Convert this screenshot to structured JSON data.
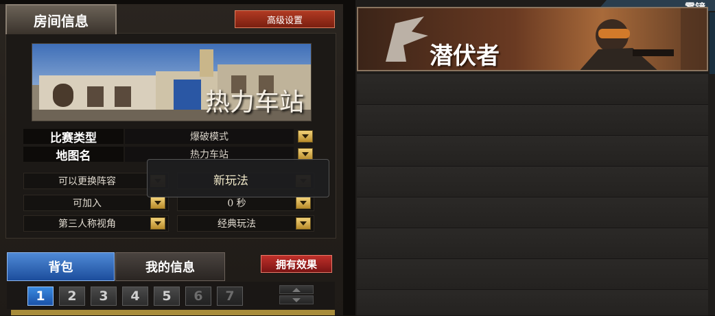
{
  "room": {
    "title": "房间信息",
    "advanced_button": "高级设置",
    "map_overlay_text": "热力车站",
    "settings": [
      {
        "label": "比赛类型",
        "value": "爆破模式"
      },
      {
        "label": "地图名",
        "value": "热力车站"
      }
    ],
    "options": {
      "change_team": "可以更换阵容",
      "joinable": "可加入",
      "timer": "0 秒",
      "third_person": "第三人称视角",
      "gameplay": "经典玩法"
    },
    "tooltip": "新玩法"
  },
  "inventory": {
    "tabs": [
      "背包",
      "我的信息"
    ],
    "active_tab": 0,
    "effect_button": "拥有效果",
    "pages": [
      "1",
      "2",
      "3",
      "4",
      "5",
      "6",
      "7"
    ],
    "active_page": 0,
    "disabled_pages": [
      5,
      6
    ]
  },
  "team": {
    "name": "潜伏者",
    "corner_text": "雾镜"
  },
  "colors": {
    "accent_blue": "#1c4d9c",
    "accent_red": "#b03a22",
    "dropdown_gold": "#f2d27a"
  }
}
